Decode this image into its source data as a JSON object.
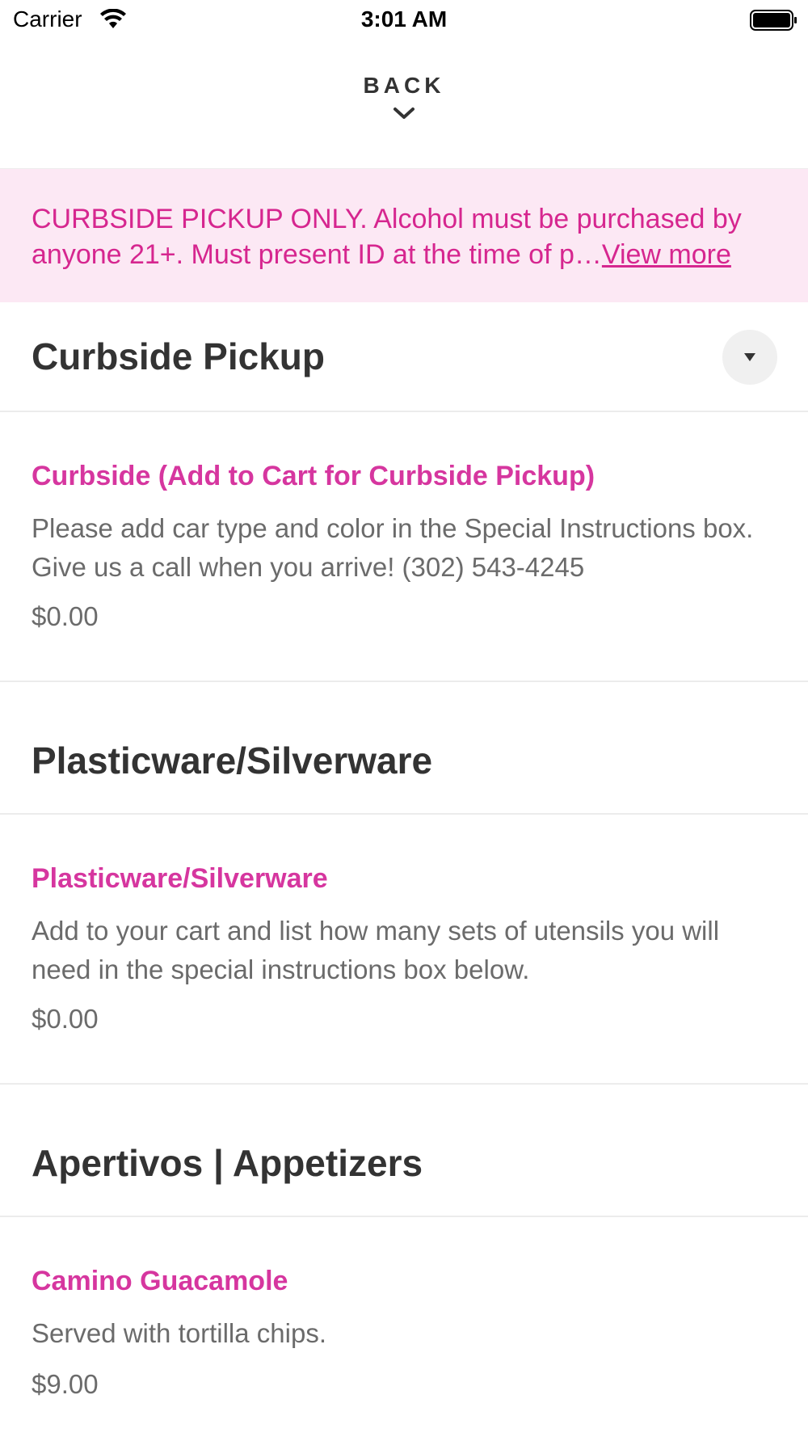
{
  "status_bar": {
    "carrier": "Carrier",
    "time": "3:01 AM"
  },
  "nav": {
    "back_label": "BACK"
  },
  "banner": {
    "line1": "CURBSIDE PICKUP ONLY. Alcohol must be purchased by",
    "line2": "anyone 21+. Must present ID at the time of p…",
    "view_more": "View more"
  },
  "sections": [
    {
      "title": "Curbside Pickup",
      "items": [
        {
          "name": "Curbside (Add to Cart for Curbside Pickup)",
          "description": "Please add car type and color in the Special Instructions box. Give us a call when you arrive! (302) 543-4245",
          "price": "$0.00"
        }
      ]
    },
    {
      "title": "Plasticware/Silverware",
      "items": [
        {
          "name": "Plasticware/Silverware",
          "description": "Add to your cart and list how many sets of utensils you will need in the special instructions box below.",
          "price": "$0.00"
        }
      ]
    },
    {
      "title": "Apertivos | Appetizers",
      "items": [
        {
          "name": "Camino Guacamole",
          "description": "Served with tortilla chips.",
          "price": "$9.00"
        }
      ]
    }
  ],
  "colors": {
    "accent": "#d6369f",
    "banner_bg": "#fce8f4",
    "title_text": "#333333",
    "body_text": "#6b6b6b"
  },
  "icons": [
    "wifi-icon",
    "battery-icon",
    "chevron-down-icon",
    "dropdown-triangle-icon"
  ]
}
